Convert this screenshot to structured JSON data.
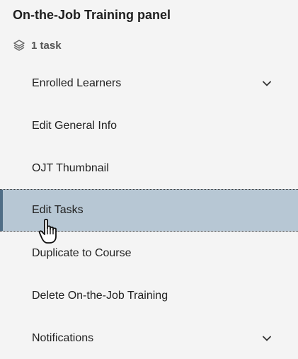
{
  "panel": {
    "title": "On-the-Job Training panel",
    "task_count": "1 task",
    "task_count_icon": "layers-icon"
  },
  "menu": {
    "items": [
      {
        "label": "Enrolled Learners",
        "has_chevron": true
      },
      {
        "label": "Edit General Info",
        "has_chevron": false
      },
      {
        "label": "OJT Thumbnail",
        "has_chevron": false
      },
      {
        "label": "Edit Tasks",
        "has_chevron": false,
        "active": true
      },
      {
        "label": "Duplicate to Course",
        "has_chevron": false
      },
      {
        "label": "Delete On-the-Job Training",
        "has_chevron": false
      },
      {
        "label": "Notifications",
        "has_chevron": true
      }
    ]
  },
  "colors": {
    "background": "#f4f4f4",
    "active_background": "#b7c7d4",
    "active_accent": "#4f6d86"
  }
}
